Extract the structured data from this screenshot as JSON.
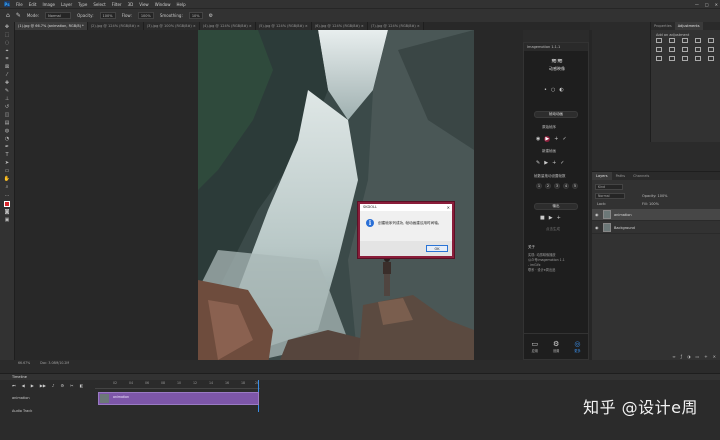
{
  "app": {
    "logo": "Ps",
    "menu": [
      "File",
      "Edit",
      "Image",
      "Layer",
      "Type",
      "Select",
      "Filter",
      "3D",
      "View",
      "Window",
      "Help"
    ],
    "window_controls": [
      "—",
      "□",
      "✕"
    ]
  },
  "options_bar": {
    "mode_label": "Mode:",
    "mode_value": "Normal",
    "opacity_label": "Opacity:",
    "opacity_value": "100%",
    "flow_label": "Flow:",
    "flow_value": "100%",
    "smoothing_label": "Smoothing:",
    "smoothing_value": "10%"
  },
  "doc_tabs": [
    {
      "label": "(1).jpg @ 66.7% (animation, RGB/8) *",
      "active": true
    },
    {
      "label": "(2).jpg @ 124% (RGB/8#) ×",
      "active": false
    },
    {
      "label": "(3).jpg @ 100% (RGB/8#) ×",
      "active": false
    },
    {
      "label": "(4).jpg @ 124% (RGB/8#) ×",
      "active": false
    },
    {
      "label": "(5).jpg @ 124% (RGB/8#) ×",
      "active": false
    },
    {
      "label": "(6).jpg @ 124% (RGB/8#) ×",
      "active": false
    },
    {
      "label": "(7).jpg @ 124% (RGB/8#) ×",
      "active": false
    }
  ],
  "dialog": {
    "title": "SKDOLL",
    "message": "创建帧序列成功, 帧动画建议用时间轴。",
    "ok_label": "OK",
    "close": "✕"
  },
  "plugin": {
    "header": "Imagemotion 1.1.1",
    "logo_mark": "≋≋",
    "logo_name": "动感映像",
    "section_frames": "帧动动画",
    "section_output": "输出帧序",
    "label_source": "原始帧序",
    "label_new": "新建帧画",
    "label_frames_count": "帧数量拖动设置帧数",
    "export_label": "输出",
    "create_label": "点击生成",
    "about_title": "关于",
    "about_lines": [
      "实现: 动感映像播放",
      "公众号imagemotion 1.1",
      "- imGifx",
      "联系 · 设计e周出品"
    ],
    "footer": [
      {
        "icon": "▭",
        "label": "应用"
      },
      {
        "icon": "⚙",
        "label": "设置"
      },
      {
        "icon": "◎",
        "label": "更多",
        "selected": true
      }
    ]
  },
  "adjustments": {
    "tabs": [
      "Properties",
      "Adjustments"
    ],
    "hint": "Add an adjustment"
  },
  "layers": {
    "tabs": [
      "Layers",
      "Paths",
      "Channels"
    ],
    "kind": "Kind",
    "blend": "Normal",
    "opacity": "Opacity: 100%",
    "fill": "Fill: 100%",
    "lock": "Lock:",
    "items": [
      {
        "name": "animation",
        "selected": true
      },
      {
        "name": "Background",
        "selected": false
      }
    ]
  },
  "status": {
    "zoom": "66.67%",
    "doc": "Doc: 3.08M/10.2M"
  },
  "timeline": {
    "tab": "Timeline",
    "ticks": [
      "02",
      "04",
      "06",
      "08",
      "10",
      "12",
      "14",
      "16",
      "18",
      "20"
    ],
    "track_main": "animation",
    "track_audio": "Audio Track",
    "clip_label": "animation"
  },
  "watermark": "知乎 @设计e周",
  "colors": {
    "accent": "#3a8ee8",
    "clip": "#7d56a8",
    "dialog_border": "#8a1d3a",
    "foreground": "#d4242a"
  }
}
